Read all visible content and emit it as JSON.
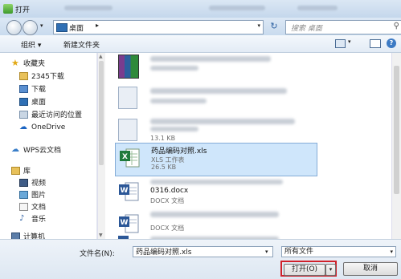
{
  "window": {
    "title": "打开"
  },
  "address": {
    "crumb": "桌面",
    "search_placeholder": "搜索 桌面"
  },
  "toolbar": {
    "organize": "组织 ▾",
    "new_folder": "新建文件夹"
  },
  "sidebar": {
    "items": [
      {
        "label": "收藏夹",
        "icon": "star-icon"
      },
      {
        "label": "2345下载",
        "icon": "folder-icon"
      },
      {
        "label": "下载",
        "icon": "download-folder-icon"
      },
      {
        "label": "桌面",
        "icon": "desktop-icon"
      },
      {
        "label": "最近访问的位置",
        "icon": "recent-places-icon"
      },
      {
        "label": "OneDrive",
        "icon": "onedrive-icon"
      },
      {
        "label": "WPS云文档",
        "icon": "cloud-icon"
      },
      {
        "label": "库",
        "icon": "library-icon"
      },
      {
        "label": "视频",
        "icon": "video-icon"
      },
      {
        "label": "图片",
        "icon": "picture-icon"
      },
      {
        "label": "文档",
        "icon": "document-icon"
      },
      {
        "label": "音乐",
        "icon": "music-icon"
      },
      {
        "label": "计算机",
        "icon": "computer-icon"
      }
    ]
  },
  "files": [
    {
      "name": "",
      "type": "",
      "size": "",
      "icon": "archive-icon"
    },
    {
      "name": "",
      "type": "",
      "size": "",
      "icon": "document-blurred-icon"
    },
    {
      "name": "",
      "type": "",
      "size": "13.1 KB",
      "icon": "document-blurred-icon"
    },
    {
      "name": "药品编码对照.xls",
      "type": "XLS 工作表",
      "size": "26.5 KB",
      "icon": "excel-icon"
    },
    {
      "name": "0316.docx",
      "type": "DOCX 文档",
      "size": "",
      "icon": "word-icon"
    },
    {
      "name": "",
      "type": "DOCX 文档",
      "size": "",
      "icon": "word-icon"
    },
    {
      "name": "",
      "type": "",
      "size": "",
      "icon": "word-icon"
    }
  ],
  "bottom": {
    "filename_label": "文件名(N):",
    "filename_value": "药品编码对照.xls",
    "filter_value": "所有文件",
    "open_label": "打开(O)",
    "cancel_label": "取消"
  },
  "colors": {
    "selection": "#cfe6fb",
    "highlight_border": "#d0202a",
    "excel_green": "#1f7a3c",
    "word_blue": "#2b5797"
  }
}
